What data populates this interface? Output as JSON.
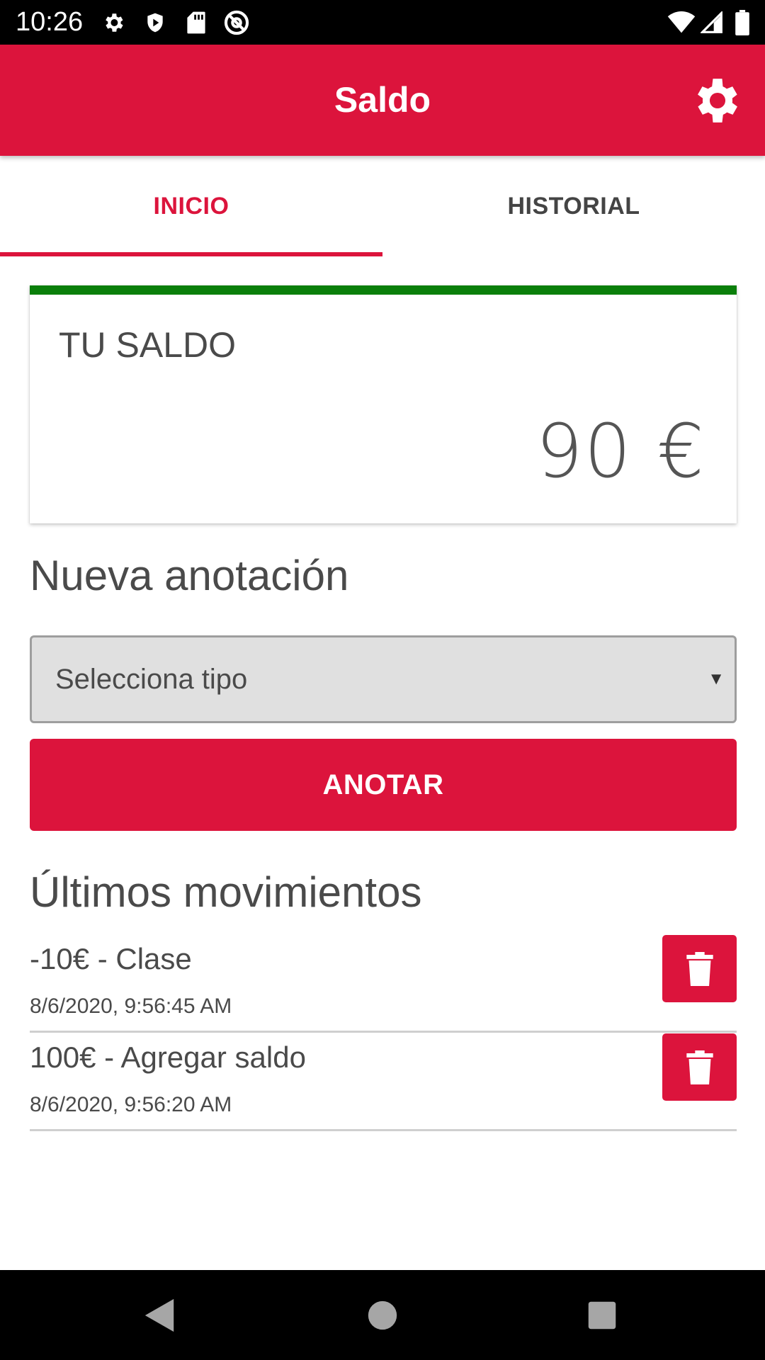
{
  "status_bar": {
    "time": "10:26",
    "icons": [
      "settings-icon",
      "shield-icon",
      "sd-card-icon",
      "at-sign-icon",
      "wifi-icon",
      "signal-icon",
      "battery-icon"
    ]
  },
  "app_bar": {
    "title": "Saldo",
    "settings_icon": "gear-icon"
  },
  "tabs": [
    {
      "label": "INICIO",
      "selected": true
    },
    {
      "label": "HISTORIAL",
      "selected": false
    }
  ],
  "balance_card": {
    "label": "TU SALDO",
    "amount": "90 €"
  },
  "new_entry": {
    "title": "Nueva anotación",
    "select_value": "Selecciona tipo",
    "select_arrow": "▼",
    "submit_label": "ANOTAR"
  },
  "movements": {
    "title": "Últimos movimientos",
    "items": [
      {
        "description": "-10€ - Clase",
        "date": "8/6/2020, 9:56:45 AM"
      },
      {
        "description": "100€ - Agregar saldo",
        "date": "8/6/2020, 9:56:20 AM"
      }
    ],
    "delete_icon": "trash-icon"
  },
  "navigation": {
    "buttons": [
      "back-icon",
      "home-icon",
      "recents-icon"
    ]
  },
  "colors": {
    "primary": "#dc143c",
    "balance_accent": "#0a7f0a",
    "text": "#4a4a4a"
  }
}
